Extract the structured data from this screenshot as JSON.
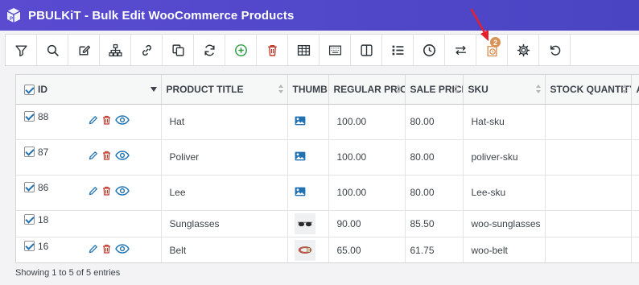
{
  "app": {
    "title": "PBULKiT - Bulk Edit WooCommerce Products",
    "accent": "#5a4bd1"
  },
  "toolbar": {
    "buttons": [
      {
        "icon": "filter-icon"
      },
      {
        "icon": "search-icon"
      },
      {
        "icon": "edit-icon"
      },
      {
        "icon": "hierarchy-icon"
      },
      {
        "icon": "link-icon"
      },
      {
        "icon": "duplicate-icon"
      },
      {
        "icon": "refresh-icon"
      },
      {
        "icon": "add-icon",
        "color": "#2e9c45"
      },
      {
        "icon": "trash-icon",
        "color": "#c0392b"
      },
      {
        "icon": "table-icon"
      },
      {
        "icon": "keyboard-icon"
      },
      {
        "icon": "columns-icon"
      },
      {
        "icon": "list-icon"
      },
      {
        "icon": "clock-icon"
      },
      {
        "icon": "swap-icon"
      },
      {
        "icon": "history-icon",
        "color": "#d99155",
        "badge": "2"
      },
      {
        "icon": "gear-icon"
      },
      {
        "icon": "undo-icon"
      }
    ]
  },
  "table": {
    "columns": [
      "ID",
      "PRODUCT TITLE",
      "THUMB",
      "REGULAR PRICE",
      "SALE PRICE",
      "SKU",
      "STOCK QUANTITY",
      "A"
    ],
    "rows": [
      {
        "id": "88",
        "title": "Hat",
        "thumb": "placeholder",
        "regular_price": "100.00",
        "sale_price": "80.00",
        "sku": "Hat-sku",
        "stock": ""
      },
      {
        "id": "87",
        "title": "Poliver",
        "thumb": "placeholder",
        "regular_price": "100.00",
        "sale_price": "80.00",
        "sku": "poliver-sku",
        "stock": ""
      },
      {
        "id": "86",
        "title": "Lee",
        "thumb": "placeholder",
        "regular_price": "100.00",
        "sale_price": "80.00",
        "sku": "Lee-sku",
        "stock": ""
      },
      {
        "id": "18",
        "title": "Sunglasses",
        "thumb": "sunglasses",
        "regular_price": "90.00",
        "sale_price": "85.50",
        "sku": "woo-sunglasses",
        "stock": ""
      },
      {
        "id": "16",
        "title": "Belt",
        "thumb": "belt",
        "regular_price": "65.00",
        "sale_price": "61.75",
        "sku": "woo-belt",
        "stock": ""
      }
    ]
  },
  "footer": {
    "entries_text": "Showing 1 to 5 of 5 entries"
  },
  "colors": {
    "action_blue": "#2271b1",
    "action_red": "#c0392b",
    "badge_orange": "#d99155"
  }
}
